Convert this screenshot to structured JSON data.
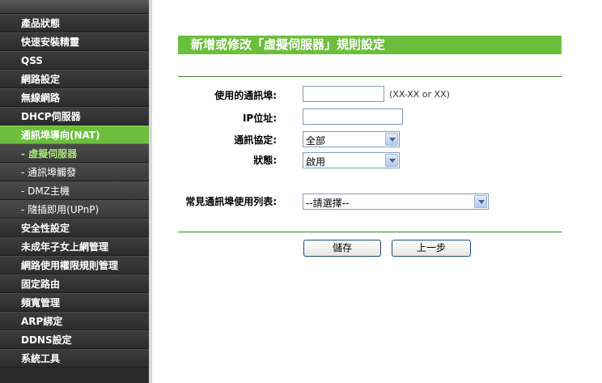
{
  "sidebar": {
    "items": [
      {
        "label": "產品狀態",
        "type": "normal"
      },
      {
        "label": "快速安裝精靈",
        "type": "normal"
      },
      {
        "label": "QSS",
        "type": "normal"
      },
      {
        "label": "網路設定",
        "type": "normal"
      },
      {
        "label": "無線網路",
        "type": "normal"
      },
      {
        "label": "DHCP伺服器",
        "type": "normal"
      },
      {
        "label": "通訊埠導向(NAT)",
        "type": "active"
      },
      {
        "label": "- 虛擬伺服器",
        "type": "sub-current"
      },
      {
        "label": "- 通訊埠觸發",
        "type": "sub"
      },
      {
        "label": "- DMZ主機",
        "type": "sub"
      },
      {
        "label": "- 隨插即用(UPnP)",
        "type": "sub"
      },
      {
        "label": "安全性設定",
        "type": "normal"
      },
      {
        "label": "未成年子女上網管理",
        "type": "normal"
      },
      {
        "label": "網路使用權限規則管理",
        "type": "normal"
      },
      {
        "label": "固定路由",
        "type": "normal"
      },
      {
        "label": "頻寬管理",
        "type": "normal"
      },
      {
        "label": "ARP綁定",
        "type": "normal"
      },
      {
        "label": "DDNS設定",
        "type": "normal"
      },
      {
        "label": "系統工具",
        "type": "normal"
      }
    ]
  },
  "main": {
    "title": "新增或修改「虛擬伺服器」規則設定",
    "form": {
      "port_label": "使用的通訊埠:",
      "port_value": "",
      "port_hint": "(XX-XX or XX)",
      "ip_label": "IP位址:",
      "ip_value": "",
      "protocol_label": "通訊協定:",
      "protocol_value": "全部",
      "status_label": "狀態:",
      "status_value": "啟用",
      "common_label": "常見通訊埠使用列表:",
      "common_value": "--請選擇--"
    },
    "buttons": {
      "save": "儲存",
      "back": "上一步"
    }
  },
  "colors": {
    "accent": "#6cbf3c",
    "sidebar_bg": "#2b2b2b"
  }
}
